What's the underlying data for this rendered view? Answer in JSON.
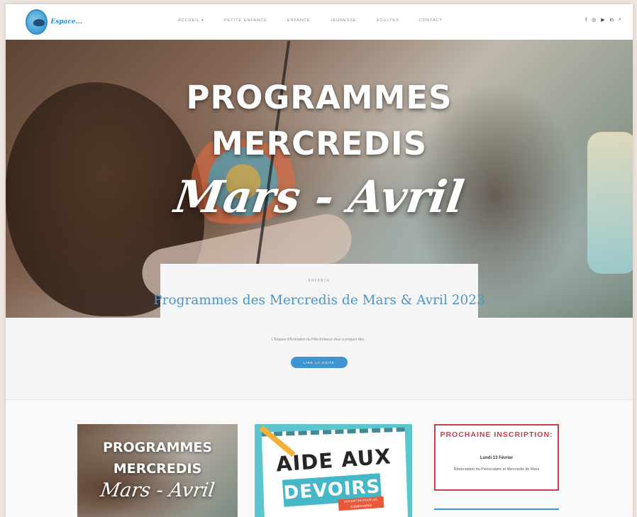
{
  "header": {
    "logo_text": "Espace...",
    "nav": [
      "Accueil ▾",
      "Petite enfance",
      "Enfance",
      "Jeunesse",
      "Adultes",
      "Contact"
    ],
    "social_icons": [
      "facebook-icon",
      "instagram-icon",
      "youtube-icon",
      "linkedin-icon",
      "search-icon"
    ]
  },
  "hero": {
    "line1": "PROGRAMMES",
    "line2": "MERCREDIS",
    "script": "Mars - Avril"
  },
  "post": {
    "category": "Enfance",
    "title": "Programmes des Mercredis de Mars & Avril 2023",
    "excerpt": "L'Espace d'Animation du Pôle Enfance vous a préparé des...",
    "read_more": "Lire la suite"
  },
  "cards": {
    "card1": {
      "line1": "PROGRAMMES",
      "line2": "MERCREDIS",
      "script": "Mars - Avril"
    },
    "card2": {
      "line1": "AIDE AUX",
      "line2": "DEVOIRS",
      "tag": "INSCRIPTION POUR LES ÉLÉMENTAIRES"
    },
    "card3": {
      "title": "PROCHAINE INSCRIPTION:",
      "date": "Lundi 13 Février",
      "desc": "Réservation du Périscolaire et Mercredis de Mars"
    }
  },
  "colors": {
    "accent_blue": "#3d95d4",
    "title_blue": "#4f94c4",
    "red": "#c6414a"
  }
}
